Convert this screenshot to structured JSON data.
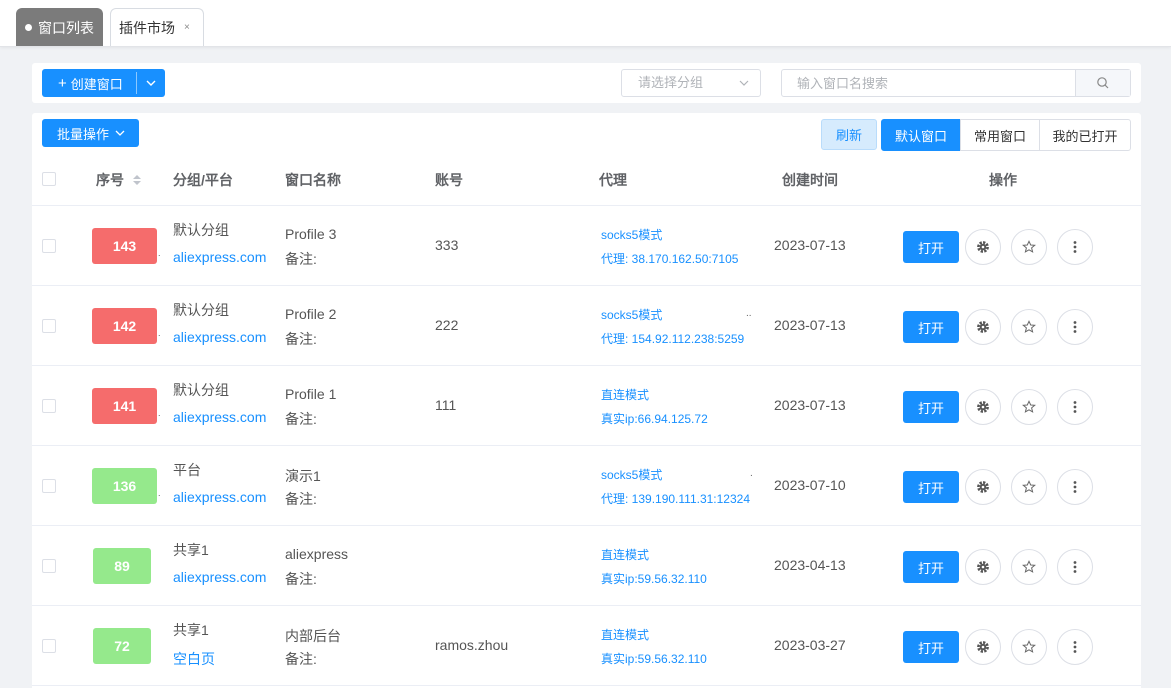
{
  "tabs": [
    {
      "label": "窗口列表"
    },
    {
      "label": "插件市场",
      "close": "×"
    }
  ],
  "toolbar": {
    "create_label": "创建窗口",
    "group_placeholder": "请选择分组",
    "search_placeholder": "输入窗口名搜索"
  },
  "actions": {
    "batch_label": "批量操作",
    "refresh_label": "刷新",
    "segments": [
      "默认窗口",
      "常用窗口",
      "我的已打开"
    ]
  },
  "table": {
    "headers": {
      "index": "序号",
      "group": "分组/平台",
      "name": "窗口名称",
      "account": "账号",
      "proxy": "代理",
      "created": "创建时间",
      "ops": "操作"
    },
    "open_label": "打开",
    "rows": [
      {
        "id": "143",
        "color": "#f56c6c",
        "group": "默认分组",
        "platform": "aliexpress.com",
        "name": "Profile 3",
        "remark": "备注:",
        "account": "333",
        "proxy_mode": "socks5模式",
        "proxy_detail": "代理: 38.170.162.50:7105",
        "created": "2023-07-13"
      },
      {
        "id": "142",
        "color": "#f56c6c",
        "group": "默认分组",
        "platform": "aliexpress.com",
        "name": "Profile 2",
        "remark": "备注:",
        "account": "222",
        "proxy_mode": "socks5模式",
        "proxy_detail": "代理: 154.92.112.238:5259",
        "created": "2023-07-13"
      },
      {
        "id": "141",
        "color": "#f56c6c",
        "group": "默认分组",
        "platform": "aliexpress.com",
        "name": "Profile 1",
        "remark": "备注:",
        "account": "111",
        "proxy_mode": "直连模式",
        "proxy_detail": "真实ip:66.94.125.72",
        "created": "2023-07-13"
      },
      {
        "id": "136",
        "color": "#95e98c",
        "group": "平台",
        "platform": "aliexpress.com",
        "name": "演示1",
        "remark": "备注:",
        "account": "",
        "proxy_mode": "socks5模式",
        "proxy_detail": "代理: 139.190.111.31:12324",
        "created": "2023-07-10"
      },
      {
        "id": "89",
        "color": "#95e98c",
        "group": "共享1",
        "platform": "aliexpress.com",
        "name": "aliexpress",
        "remark": "备注:",
        "account": "",
        "proxy_mode": "直连模式",
        "proxy_detail": "真实ip:59.56.32.110",
        "created": "2023-04-13"
      },
      {
        "id": "72",
        "color": "#95e98c",
        "group": "共享1",
        "platform": "空白页",
        "name": "内部后台",
        "remark": "备注:",
        "account": "ramos.zhou",
        "proxy_mode": "直连模式",
        "proxy_detail": "真实ip:59.56.32.110",
        "created": "2023-03-27"
      }
    ]
  }
}
